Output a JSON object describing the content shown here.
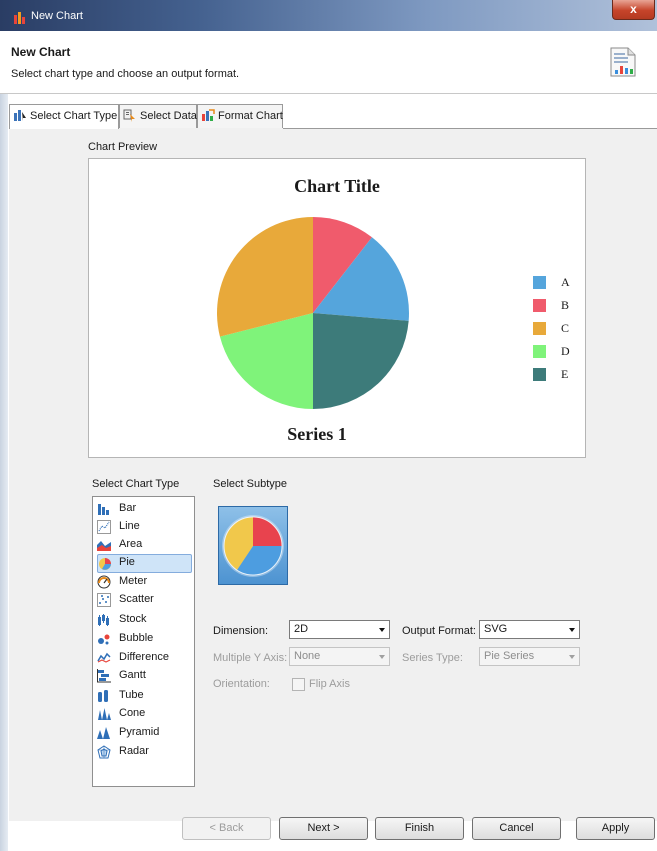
{
  "window": {
    "title": "New Chart",
    "close_label": "x"
  },
  "header": {
    "title": "New Chart",
    "description": "Select chart type and choose an output format."
  },
  "tabs": [
    {
      "label": "Select Chart Type",
      "active": true
    },
    {
      "label": "Select Data",
      "active": false
    },
    {
      "label": "Format Chart",
      "active": false
    }
  ],
  "preview": {
    "section_label": "Chart Preview",
    "chart_title": "Chart Title",
    "series_label": "Series 1"
  },
  "chart_data": {
    "type": "pie",
    "title": "Chart Title",
    "series_label": "Series 1",
    "legend_position": "right",
    "categories": [
      "A",
      "B",
      "C",
      "D",
      "E"
    ],
    "values": [
      6,
      4,
      11,
      8,
      9
    ],
    "colors": [
      "#55a5dc",
      "#f05b6c",
      "#e8a93a",
      "#7ff37a",
      "#3d7b7a"
    ]
  },
  "chart_types": {
    "label": "Select Chart Type",
    "selected": "Pie",
    "items": [
      {
        "label": "Bar",
        "icon": "bar-chart-icon"
      },
      {
        "label": "Line",
        "icon": "line-chart-icon"
      },
      {
        "label": "Area",
        "icon": "area-chart-icon"
      },
      {
        "label": "Pie",
        "icon": "pie-chart-icon"
      },
      {
        "label": "Meter",
        "icon": "meter-chart-icon"
      },
      {
        "label": "Scatter",
        "icon": "scatter-chart-icon"
      },
      {
        "label": "Stock",
        "icon": "stock-chart-icon"
      },
      {
        "label": "Bubble",
        "icon": "bubble-chart-icon"
      },
      {
        "label": "Difference",
        "icon": "difference-chart-icon"
      },
      {
        "label": "Gantt",
        "icon": "gantt-chart-icon"
      },
      {
        "label": "Tube",
        "icon": "tube-chart-icon"
      },
      {
        "label": "Cone",
        "icon": "cone-chart-icon"
      },
      {
        "label": "Pyramid",
        "icon": "pyramid-chart-icon"
      },
      {
        "label": "Radar",
        "icon": "radar-chart-icon"
      }
    ]
  },
  "subtype": {
    "label": "Select Subtype"
  },
  "options": {
    "dimension_label": "Dimension:",
    "dimension_value": "2D",
    "output_format_label": "Output Format:",
    "output_format_value": "SVG",
    "multiple_y_axis_label": "Multiple Y Axis:",
    "multiple_y_axis_value": "None",
    "series_type_label": "Series Type:",
    "series_type_value": "Pie Series",
    "orientation_label": "Orientation:",
    "flip_axis_label": "Flip Axis"
  },
  "buttons": {
    "back": "< Back",
    "next": "Next >",
    "finish": "Finish",
    "cancel": "Cancel",
    "apply": "Apply"
  }
}
